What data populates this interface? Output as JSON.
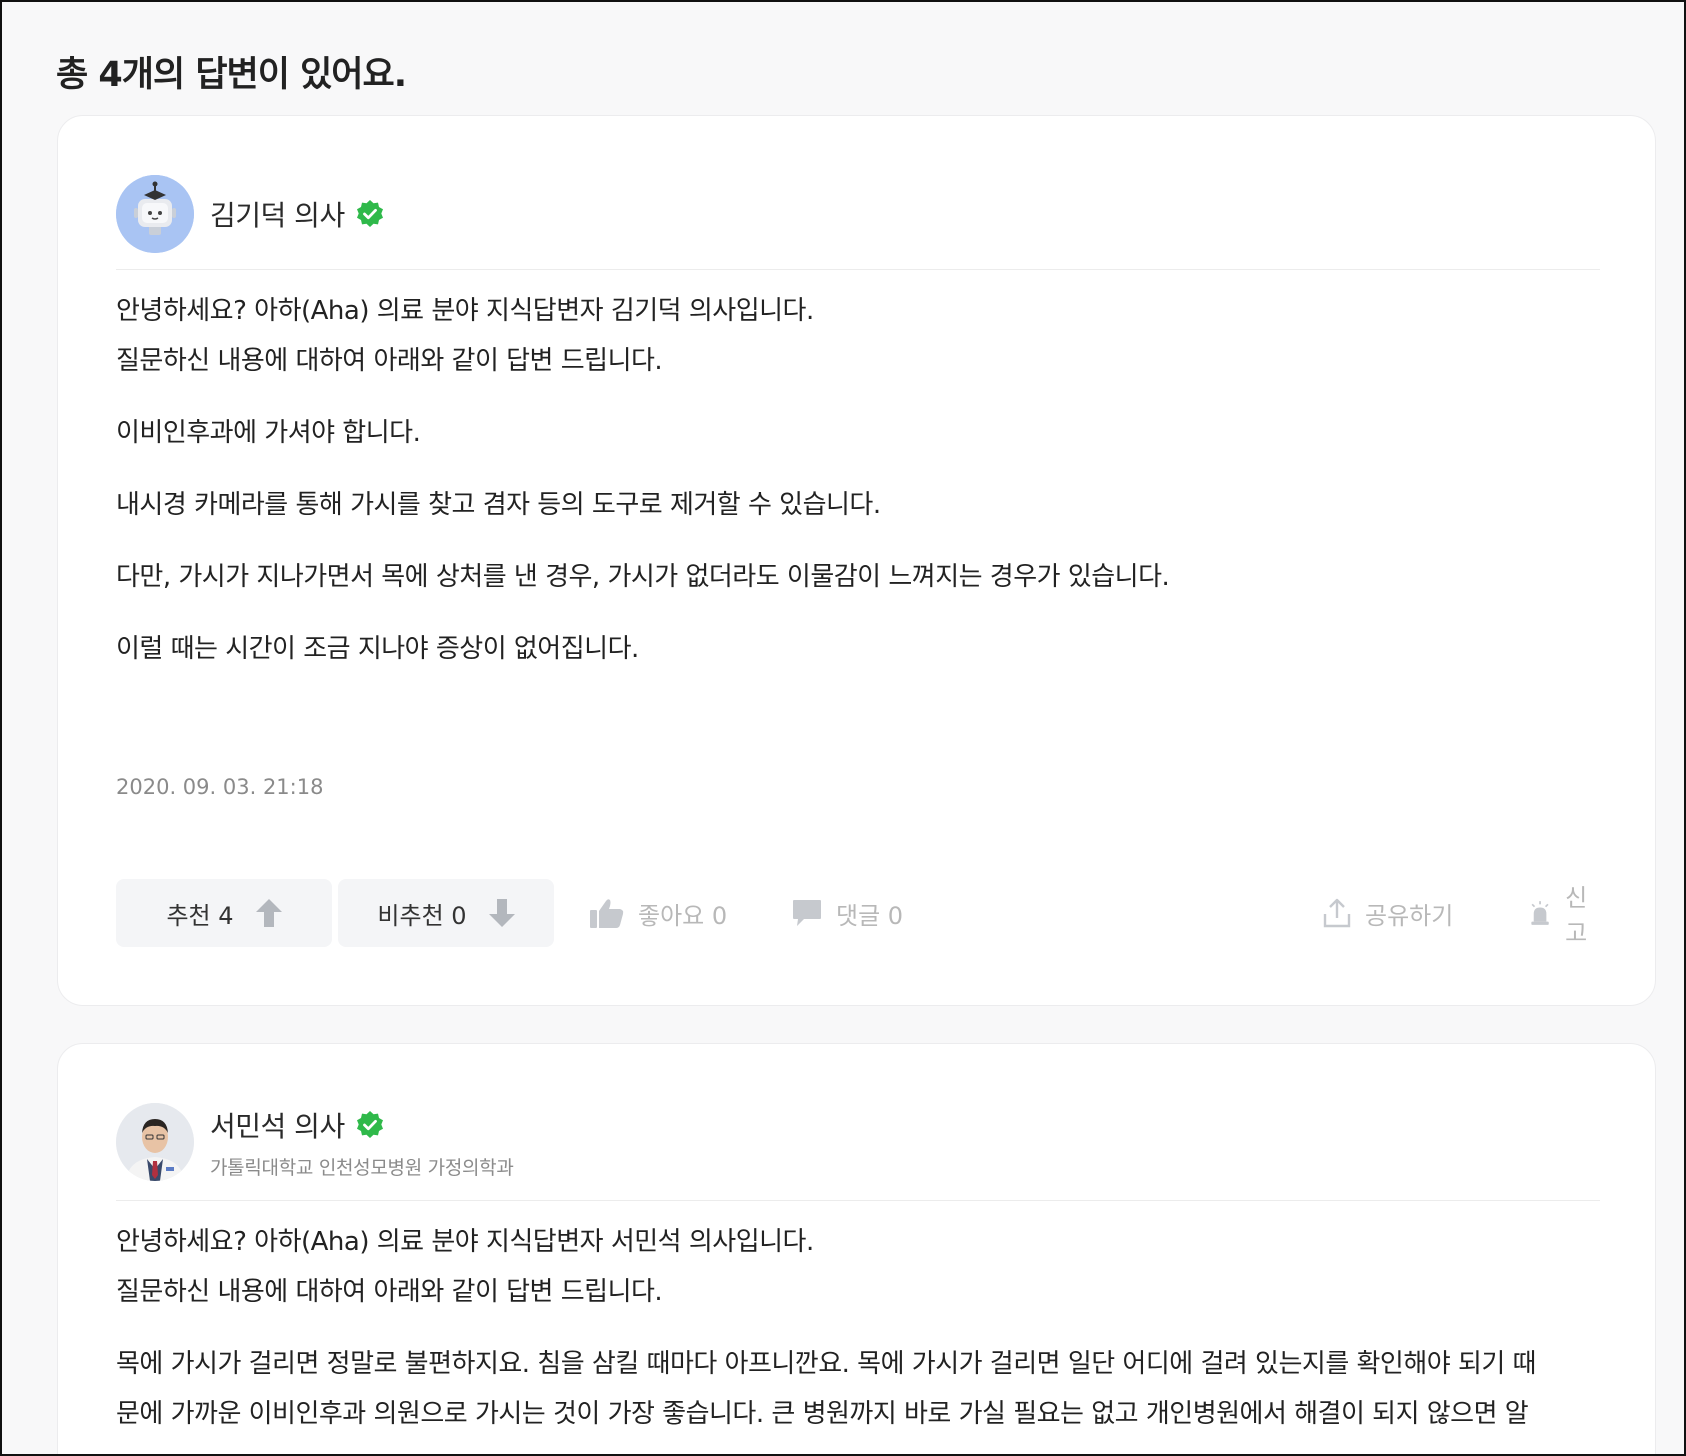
{
  "page": {
    "heading": "총 4개의 답변이 있어요."
  },
  "answers": [
    {
      "author_name": "김기덕 의사",
      "affiliation": "",
      "avatar_icon": "robot-avatar",
      "paragraphs": [
        [
          "안녕하세요? 아하(Aha) 의료 분야 지식답변자 김기덕 의사입니다.",
          "질문하신 내용에 대하여 아래와 같이 답변 드립니다."
        ],
        [
          "이비인후과에 가셔야 합니다."
        ],
        [
          "내시경 카메라를 통해 가시를 찾고 겸자 등의 도구로 제거할 수 있습니다."
        ],
        [
          "다만, 가시가 지나가면서 목에 상처를 낸 경우, 가시가 없더라도 이물감이 느껴지는 경우가 있습니다."
        ],
        [
          "이럴 때는 시간이 조금 지나야 증상이 없어집니다."
        ]
      ],
      "date": "2020. 09. 03. 21:18",
      "actions": {
        "upvote_label": "추천 4",
        "downvote_label": "비추천 0",
        "like_label": "좋아요 0",
        "comment_label": "댓글 0",
        "share_label": "공유하기",
        "report_label": "신고"
      }
    },
    {
      "author_name": "서민석 의사",
      "affiliation": "가톨릭대학교 인천성모병원 가정의학과",
      "avatar_icon": "doctor-photo-avatar",
      "paragraphs": [
        [
          "안녕하세요? 아하(Aha) 의료 분야 지식답변자 서민석 의사입니다.",
          "질문하신 내용에 대하여 아래와 같이 답변 드립니다."
        ],
        [
          "목에 가시가 걸리면 정말로 불편하지요. 침을 삼킬 때마다 아프니깐요. 목에 가시가 걸리면 일단 어디에 걸려 있는지를 확인해야 되기 때",
          "문에 가까운 이비인후과 의원으로 가시는 것이 가장 좋습니다. 큰 병원까지 바로 가실 필요는 없고 개인병원에서 해결이 되지 않으면 알"
        ]
      ]
    }
  ],
  "colors": {
    "verified": "#2fb94a",
    "card_border": "#ececee",
    "page_bg": "#f8f8f9",
    "muted_text": "#8a8a8a",
    "action_gray": "#b8b8b8"
  }
}
